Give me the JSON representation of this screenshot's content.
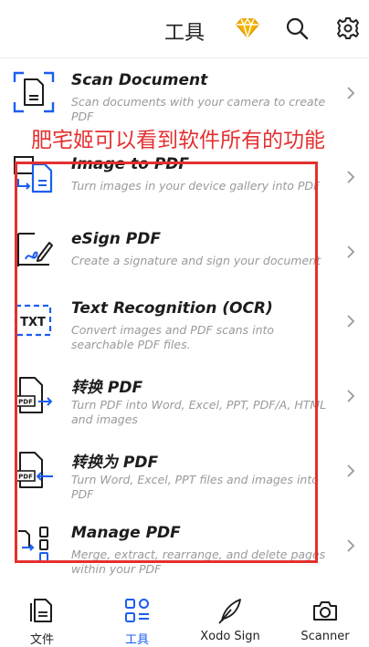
{
  "header": {
    "title": "工具"
  },
  "annotation": {
    "text": "肥宅姬可以看到软件所有的功能"
  },
  "tools": [
    {
      "name": "Scan Document",
      "desc": "Scan documents with your camera to create PDF"
    },
    {
      "name": "Image to PDF",
      "desc": "Turn images in your device gallery into PDF"
    },
    {
      "name": "eSign PDF",
      "desc": "Create a signature and sign your document"
    },
    {
      "name": "Text Recognition (OCR)",
      "desc": "Convert images and PDF scans into searchable PDF files.",
      "icon_text": "TXT"
    },
    {
      "name": "转换 PDF",
      "desc": "Turn PDF into Word, Excel, PPT, PDF/A, HTML and images",
      "icon_text": "PDF"
    },
    {
      "name": "转换为 PDF",
      "desc": "Turn Word, Excel, PPT files and images into PDF",
      "icon_text": "PDF"
    },
    {
      "name": "Manage PDF",
      "desc": "Merge, extract, rearrange, and delete pages within your PDF"
    }
  ],
  "tabs": [
    {
      "label": "文件",
      "active": false
    },
    {
      "label": "工具",
      "active": true
    },
    {
      "label": "Xodo Sign",
      "active": false
    },
    {
      "label": "Scanner",
      "active": false
    }
  ],
  "colors": {
    "accent_blue": "#1a5ef0",
    "premium_gold": "#f4b400",
    "annotation_red": "#e53030"
  }
}
